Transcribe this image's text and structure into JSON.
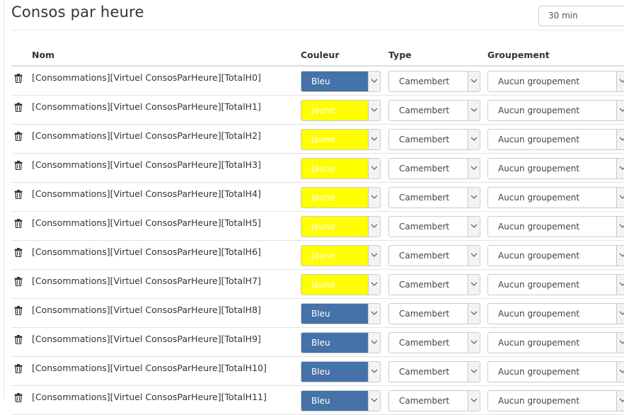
{
  "title": "Consos par heure",
  "period": {
    "value": "30 min"
  },
  "columns": {
    "name": "Nom",
    "color": "Couleur",
    "type": "Type",
    "grouping": "Groupement"
  },
  "colors": {
    "Bleu": "#4572a7",
    "Jaune": "#ffff00"
  },
  "icons": {
    "delete": "trash-icon",
    "dropdown": "chevron-down-icon"
  },
  "rows": [
    {
      "name": "[Consommations][Virtuel ConsosParHeure][TotalH0]",
      "color": "Bleu",
      "type": "Camembert",
      "grouping": "Aucun groupement"
    },
    {
      "name": "[Consommations][Virtuel ConsosParHeure][TotalH1]",
      "color": "Jaune",
      "type": "Camembert",
      "grouping": "Aucun groupement"
    },
    {
      "name": "[Consommations][Virtuel ConsosParHeure][TotalH2]",
      "color": "Jaune",
      "type": "Camembert",
      "grouping": "Aucun groupement"
    },
    {
      "name": "[Consommations][Virtuel ConsosParHeure][TotalH3]",
      "color": "Jaune",
      "type": "Camembert",
      "grouping": "Aucun groupement"
    },
    {
      "name": "[Consommations][Virtuel ConsosParHeure][TotalH4]",
      "color": "Jaune",
      "type": "Camembert",
      "grouping": "Aucun groupement"
    },
    {
      "name": "[Consommations][Virtuel ConsosParHeure][TotalH5]",
      "color": "Jaune",
      "type": "Camembert",
      "grouping": "Aucun groupement"
    },
    {
      "name": "[Consommations][Virtuel ConsosParHeure][TotalH6]",
      "color": "Jaune",
      "type": "Camembert",
      "grouping": "Aucun groupement"
    },
    {
      "name": "[Consommations][Virtuel ConsosParHeure][TotalH7]",
      "color": "Jaune",
      "type": "Camembert",
      "grouping": "Aucun groupement"
    },
    {
      "name": "[Consommations][Virtuel ConsosParHeure][TotalH8]",
      "color": "Bleu",
      "type": "Camembert",
      "grouping": "Aucun groupement"
    },
    {
      "name": "[Consommations][Virtuel ConsosParHeure][TotalH9]",
      "color": "Bleu",
      "type": "Camembert",
      "grouping": "Aucun groupement"
    },
    {
      "name": "[Consommations][Virtuel ConsosParHeure][TotalH10]",
      "color": "Bleu",
      "type": "Camembert",
      "grouping": "Aucun groupement"
    },
    {
      "name": "[Consommations][Virtuel ConsosParHeure][TotalH11]",
      "color": "Bleu",
      "type": "Camembert",
      "grouping": "Aucun groupement"
    }
  ]
}
